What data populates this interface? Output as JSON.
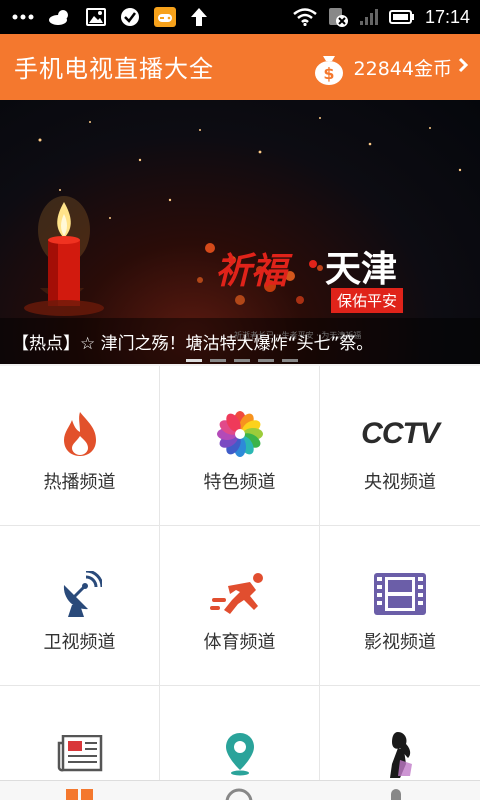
{
  "status_bar": {
    "time": "17:14",
    "left_icons": [
      "more-icon",
      "weather-icon",
      "gallery-icon",
      "check-icon",
      "game-icon",
      "upload-icon"
    ],
    "right_icons": [
      "wifi-icon",
      "sim-icon",
      "signal-icon",
      "battery-icon"
    ]
  },
  "header": {
    "title": "手机电视直播大全",
    "coins": "22844金币",
    "accent": "#f4782e"
  },
  "banner": {
    "caption": "【热点】☆ 津门之殇！塘沽特大爆炸“头七”祭。",
    "art_title_red": "祈福",
    "art_title_white": "天津",
    "art_subtitle": "保佑平安",
    "art_small": "祈逝者长已 · 生者平安 · 为天津祈福",
    "slide_count": 5,
    "active_slide": 0
  },
  "categories": [
    {
      "label": "热播频道",
      "icon": "fire-icon"
    },
    {
      "label": "特色频道",
      "icon": "flower-icon"
    },
    {
      "label": "央视频道",
      "icon": "cctv-logo-icon",
      "logo_text": "CCTV"
    },
    {
      "label": "卫视频道",
      "icon": "satellite-dish-icon"
    },
    {
      "label": "体育频道",
      "icon": "runner-icon"
    },
    {
      "label": "影视频道",
      "icon": "film-icon"
    },
    {
      "label": "",
      "icon": "newspaper-icon"
    },
    {
      "label": "",
      "icon": "map-pin-icon"
    },
    {
      "label": "",
      "icon": "woman-silhouette-icon"
    }
  ],
  "bottom_nav": [
    "home-tab-icon",
    "play-tab-icon",
    "mic-tab-icon"
  ]
}
